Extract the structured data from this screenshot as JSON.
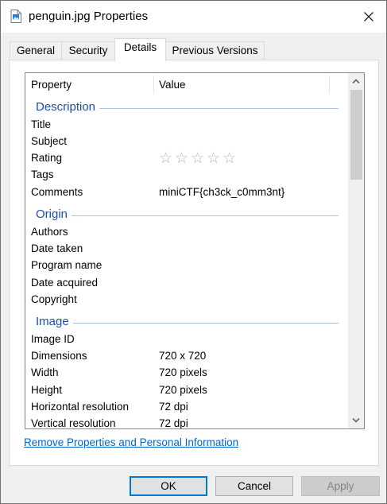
{
  "window": {
    "title": "penguin.jpg Properties",
    "close_icon": "close-icon",
    "file_icon": "image-file-icon"
  },
  "tabs": [
    {
      "label": "General",
      "active": false
    },
    {
      "label": "Security",
      "active": false
    },
    {
      "label": "Details",
      "active": true
    },
    {
      "label": "Previous Versions",
      "active": false
    }
  ],
  "list": {
    "header": {
      "property": "Property",
      "value": "Value"
    },
    "groups": {
      "description": "Description",
      "origin": "Origin",
      "image": "Image"
    },
    "rows": {
      "title": {
        "k": "Title",
        "v": ""
      },
      "subject": {
        "k": "Subject",
        "v": ""
      },
      "rating": {
        "k": "Rating",
        "v": "☆☆☆☆☆"
      },
      "tags": {
        "k": "Tags",
        "v": ""
      },
      "comments": {
        "k": "Comments",
        "v": "miniCTF{ch3ck_c0mm3nt}"
      },
      "authors": {
        "k": "Authors",
        "v": ""
      },
      "date_taken": {
        "k": "Date taken",
        "v": ""
      },
      "program_name": {
        "k": "Program name",
        "v": ""
      },
      "date_acquired": {
        "k": "Date acquired",
        "v": ""
      },
      "copyright": {
        "k": "Copyright",
        "v": ""
      },
      "image_id": {
        "k": "Image ID",
        "v": ""
      },
      "dimensions": {
        "k": "Dimensions",
        "v": "720 x 720"
      },
      "width": {
        "k": "Width",
        "v": "720 pixels"
      },
      "height": {
        "k": "Height",
        "v": "720 pixels"
      },
      "h_res": {
        "k": "Horizontal resolution",
        "v": "72 dpi"
      },
      "v_res": {
        "k": "Vertical resolution",
        "v": "72 dpi"
      }
    }
  },
  "links": {
    "remove_properties": "Remove Properties and Personal Information"
  },
  "buttons": {
    "ok": "OK",
    "cancel": "Cancel",
    "apply": "Apply"
  },
  "colors": {
    "group_header": "#1e4fa8",
    "link": "#0066cc",
    "focus_border": "#0078d7"
  }
}
